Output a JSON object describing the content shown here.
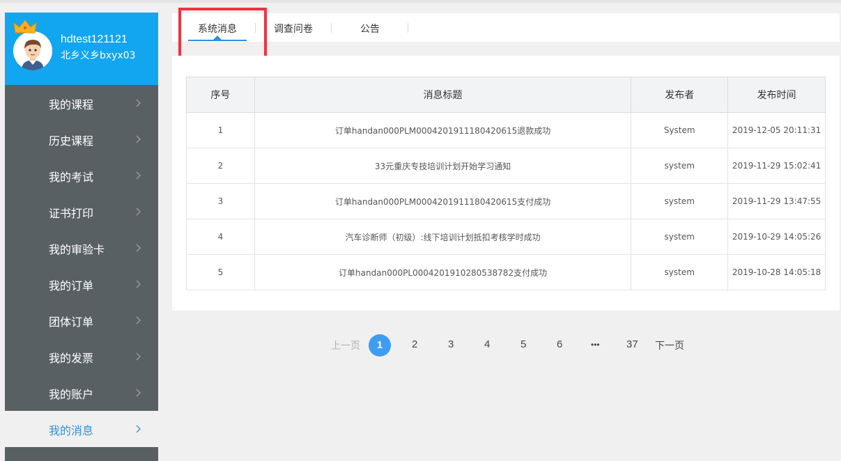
{
  "user": {
    "name": "hdtest121121",
    "org": "北乡义乡bxyx03"
  },
  "menu": [
    {
      "label": "我的课程",
      "active": false
    },
    {
      "label": "历史课程",
      "active": false
    },
    {
      "label": "我的考试",
      "active": false
    },
    {
      "label": "证书打印",
      "active": false
    },
    {
      "label": "我的审验卡",
      "active": false
    },
    {
      "label": "我的订单",
      "active": false
    },
    {
      "label": "团体订单",
      "active": false
    },
    {
      "label": "我的发票",
      "active": false
    },
    {
      "label": "我的账户",
      "active": false
    },
    {
      "label": "我的消息",
      "active": true
    }
  ],
  "tabs": [
    {
      "label": "系统消息",
      "active": true
    },
    {
      "label": "调查问卷",
      "active": false
    },
    {
      "label": "公告",
      "active": false
    }
  ],
  "table": {
    "headers": [
      "序号",
      "消息标题",
      "发布者",
      "发布时间"
    ],
    "rows": [
      [
        "1",
        "订单handan000PLM0004201911180420615退款成功",
        "System",
        "2019-12-05 20:11:31"
      ],
      [
        "2",
        "33元重庆专技培训计划开始学习通知",
        "system",
        "2019-11-29 15:02:41"
      ],
      [
        "3",
        "订单handan000PLM0004201911180420615支付成功",
        "system",
        "2019-11-29 13:47:55"
      ],
      [
        "4",
        "汽车诊断师（初级）:线下培训计划抵扣考核学时成功",
        "system",
        "2019-10-29 14:05:26"
      ],
      [
        "5",
        "订单handan000PL0004201910280538782支付成功",
        "system",
        "2019-10-28 14:05:18"
      ]
    ]
  },
  "pagination": {
    "prev": "上一页",
    "current": "1",
    "pages": [
      "2",
      "3",
      "4",
      "5",
      "6"
    ],
    "ellipsis": "•••",
    "last": "37",
    "next": "下一页"
  },
  "colors": {
    "accent": "#2e8fdf",
    "profile_bg": "#12a5f0",
    "sidebar_bg": "#596064",
    "highlight": "#ef3340"
  }
}
